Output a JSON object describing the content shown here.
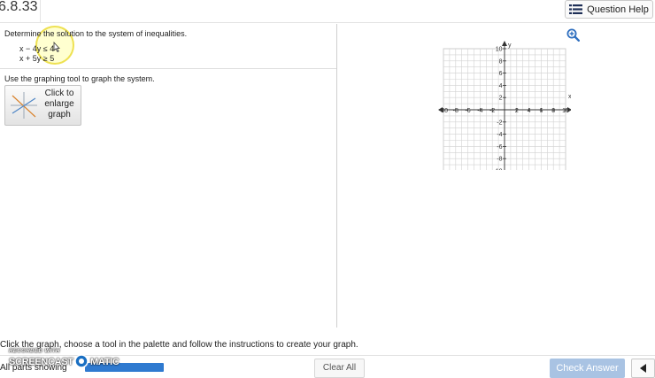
{
  "header": {
    "problem_id": "6.8.33",
    "help_label": "Question Help"
  },
  "question": {
    "prompt": "Determine the solution to the system of inequalities.",
    "system": [
      "x − 4y ≤ 4",
      "x + 5y ≥ 5"
    ],
    "graph_instruction": "Use the graphing tool to graph the system.",
    "enlarge_label": "Click to enlarge graph"
  },
  "graph": {
    "x_label": "x",
    "y_label": "y",
    "x_range": [
      -10,
      10
    ],
    "y_range": [
      -10,
      10
    ],
    "grid": true,
    "tick_labels": [
      "-10",
      "-8",
      "-6",
      "-4",
      "-2",
      "2",
      "4",
      "6",
      "8",
      "10"
    ]
  },
  "footer": {
    "instruction": "Click the graph, choose a tool in the palette and follow the instructions to create your graph.",
    "parts_label": "All parts showing",
    "clear_label": "Clear All",
    "check_label": "Check Answer",
    "watermark_top": "RECORDED WITH",
    "watermark_left": "SCREENCAST",
    "watermark_right": "MATIC"
  },
  "colors": {
    "accent": "#2f7ad0",
    "check_button_disabled": "#a9c3e3",
    "highlight": "#ebdc3c"
  },
  "icons": {
    "help": "list-icon",
    "zoom": "zoom-in-icon",
    "next": "triangle-left-icon"
  }
}
